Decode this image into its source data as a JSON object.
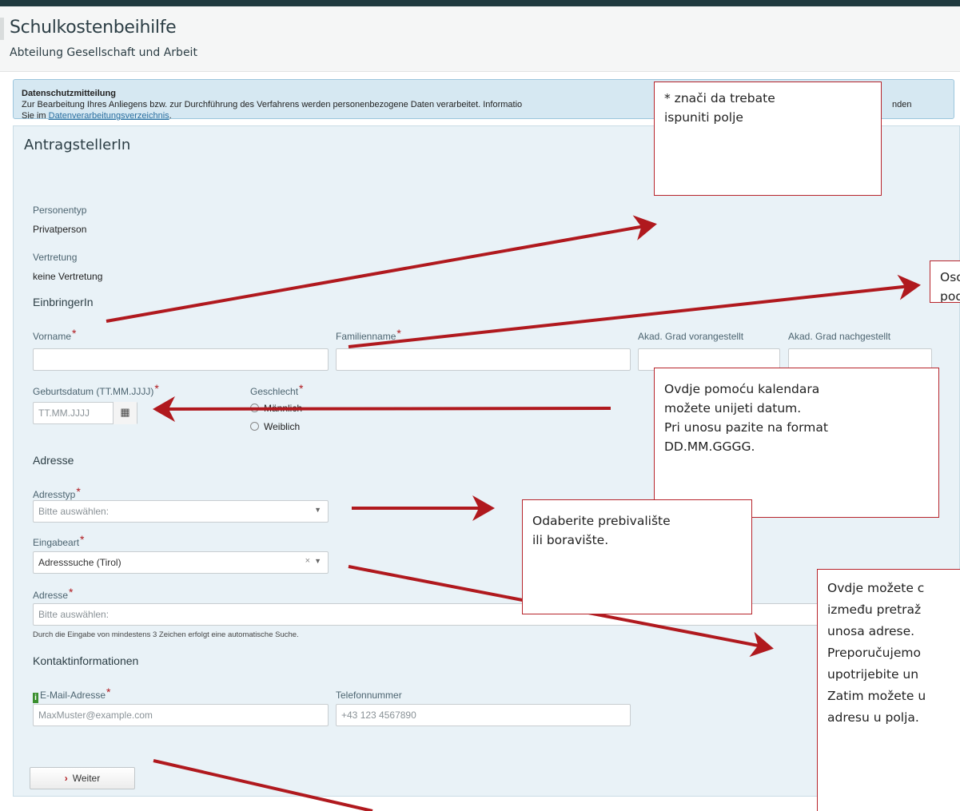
{
  "header": {
    "title": "Schulkostenbeihilfe",
    "subtitle": "Abteilung Gesellschaft und Arbeit"
  },
  "privacy": {
    "title": "Datenschutzmitteilung",
    "line1": "Zur Bearbeitung Ihres Anliegens bzw. zur Durchführung des Verfahrens werden personenbezogene Daten verarbeitet. Informatio",
    "line2_prefix": "Sie im ",
    "link": "Datenverarbeitungsverzeichnis",
    "line2_suffix": ".",
    "tail": "nden"
  },
  "panel": {
    "title": "AntragstellerIn"
  },
  "person": {
    "type_label": "Personentyp",
    "type_value": "Privatperson",
    "rep_label": "Vertretung",
    "rep_value": "keine Vertretung"
  },
  "einbringer": {
    "section": "EinbringerIn",
    "firstname_label": "Vorname",
    "lastname_label": "Familienname",
    "title_pre_label": "Akad. Grad vorangestellt",
    "title_post_label": "Akad. Grad nachgestellt",
    "birthdate_label": "Geburtsdatum (TT.MM.JJJJ)",
    "birthdate_placeholder": "TT.MM.JJJJ",
    "gender_label": "Geschlecht",
    "gender_options": [
      "Männlich",
      "Weiblich"
    ],
    "required_mark": "*"
  },
  "address": {
    "section": "Adresse",
    "type_label": "Adresstyp",
    "type_value": "Bitte auswählen:",
    "mode_label": "Eingabeart",
    "mode_value": "Adresssuche (Tirol)",
    "address_label": "Adresse",
    "address_value": "Bitte auswählen:",
    "hint": "Durch die Eingabe von mindestens 3 Zeichen erfolgt eine automatische Suche."
  },
  "contact": {
    "section": "Kontaktinformationen",
    "email_label": "E-Mail-Adresse",
    "email_placeholder": "MaxMuster@example.com",
    "phone_label": "Telefonnummer",
    "phone_placeholder": "+43 123 4567890",
    "info_icon": "i"
  },
  "buttons": {
    "next": "Weiter",
    "next_icon": "›"
  },
  "icons": {
    "calendar": "calendar-icon",
    "dropdown": "chevron-down-icon"
  },
  "notes": {
    "required": [
      "* znači da trebate",
      "ispuniti polje"
    ],
    "person": [
      "Osob",
      "podr"
    ],
    "calendar": [
      "Ovdje pomoću kalendara",
      "možete unijeti datum.",
      "Pri unosu pazite na format",
      "DD.MM.GGGG."
    ],
    "residence": [
      "Odaberite prebivalište",
      "ili boravište."
    ],
    "address": [
      "Ovdje možete c",
      "između pretraž",
      "unosa adrese.",
      "Preporučujemo",
      "upotrijebite un",
      "Zatim možete u",
      "adresu u polja."
    ]
  },
  "colors": {
    "required": "#b0191e",
    "arrow": "#b0191e",
    "topbar": "#1f3a3f",
    "info_box": "#d6e8f2"
  }
}
